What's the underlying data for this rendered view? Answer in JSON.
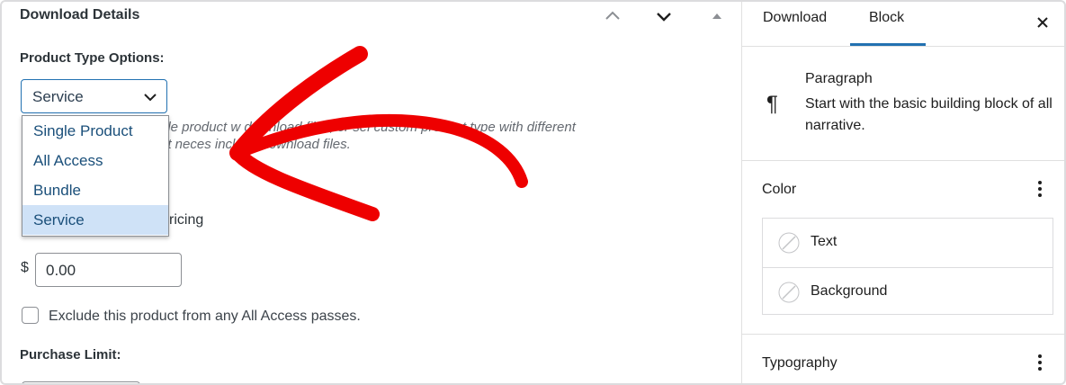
{
  "left_panel": {
    "title": "Download Details",
    "product_type_label": "Product Type Options:",
    "product_type_value": "Service",
    "dropdown_options": [
      "Single Product",
      "All Access",
      "Bundle",
      "Service"
    ],
    "help_text_line1": "gle product w   download files, or sel     custom product type with different",
    "help_text_line2": "ot neces      include download files.",
    "pricing_fragment": "ricing",
    "currency_symbol": "$",
    "price_value": "0.00",
    "exclude_label": "Exclude this product from any All Access passes.",
    "purchase_limit_label": "Purchase Limit:"
  },
  "right_panel": {
    "tabs": [
      "Download",
      "Block"
    ],
    "active_tab": "Block",
    "block_name": "Paragraph",
    "block_description": "Start with the basic building block of all narrative.",
    "color_section_title": "Color",
    "color_items": [
      "Text",
      "Background"
    ],
    "typography_section_title": "Typography"
  },
  "icons": {
    "header": [
      "chevron-up-icon",
      "chevron-down-icon",
      "caret-up-icon"
    ],
    "close": "close-icon",
    "block": "pilcrow-icon",
    "menu": "more-vertical-icon",
    "swatch": "no-color-swatch-icon"
  },
  "colors": {
    "accent": "#2271b1",
    "annotation_arrow": "#ee0000",
    "selected_option": "#cfe2f7"
  }
}
